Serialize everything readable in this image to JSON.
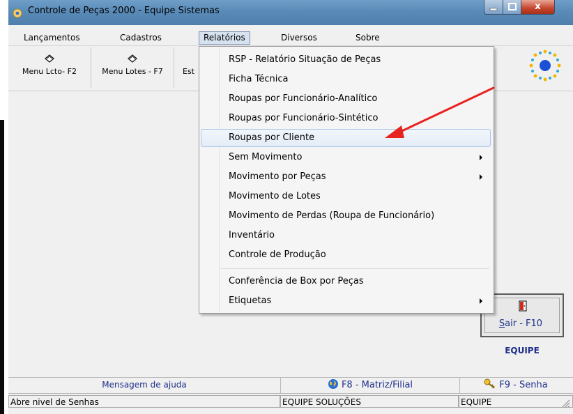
{
  "window": {
    "title": "Controle de Peças 2000 - Equipe Sistemas",
    "close_glyph": "x"
  },
  "menubar": {
    "items": [
      "Lançamentos",
      "Cadastros",
      "Relatórios",
      "Diversos",
      "Sobre"
    ]
  },
  "toolbar": {
    "buttons": [
      {
        "label": "Menu Lcto- F2",
        "icon": "book-icon"
      },
      {
        "label": "Menu Lotes - F7",
        "icon": "book-icon"
      },
      {
        "label": "Est",
        "icon": "book-icon"
      }
    ]
  },
  "dropdown": {
    "items": [
      {
        "label": "RSP - Relatório Situação de Peças",
        "submenu": false
      },
      {
        "label": "Ficha Técnica",
        "submenu": false
      },
      {
        "label": "Roupas por Funcionário-Analítico",
        "submenu": false
      },
      {
        "label": "Roupas por Funcionário-Sintético",
        "submenu": false
      },
      {
        "label": "Roupas por Cliente",
        "submenu": false,
        "highlighted": true
      },
      {
        "label": "Sem Movimento",
        "submenu": true
      },
      {
        "label": "Movimento por Peças",
        "submenu": true
      },
      {
        "label": "Movimento de Lotes",
        "submenu": false
      },
      {
        "label": "Movimento de Perdas (Roupa de Funcionário)",
        "submenu": false
      },
      {
        "label": "Inventário",
        "submenu": false
      },
      {
        "label": "Controle de Produção",
        "submenu": false
      },
      {
        "label": "Conferência de Box por Peças",
        "submenu": false
      },
      {
        "label": "Etiquetas",
        "submenu": true
      }
    ]
  },
  "exit": {
    "label_underlined": "S",
    "label_rest": "air - F10",
    "brand": "EQUIPE"
  },
  "helpbar": {
    "title": "Mensagem de ajuda",
    "f8": "F8 - Matriz/Filial",
    "f9": "F9 - Senha"
  },
  "statusbar": {
    "left": "Abre nivel de Senhas",
    "middle": "EQUIPE SOLUÇÕES",
    "right": "EQUIPE"
  },
  "colors": {
    "accent_text": "#1e2f8a",
    "highlight_border": "#a8c5e8",
    "annotation_arrow": "#e8231f"
  }
}
